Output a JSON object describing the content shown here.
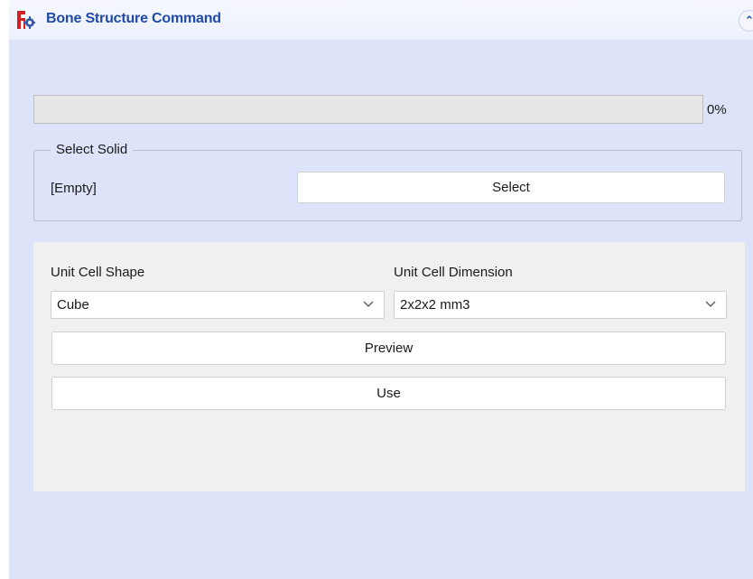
{
  "window": {
    "title": "Bone Structure Command"
  },
  "progress": {
    "value": 0,
    "text": "0%"
  },
  "select_solid": {
    "title": "Select Solid",
    "status": "[Empty]",
    "button_label": "Select"
  },
  "unit_cell": {
    "shape_label": "Unit Cell Shape",
    "shape_value": "Cube",
    "dimension_label": "Unit Cell Dimension",
    "dimension_value": "2x2x2 mm3"
  },
  "actions": {
    "preview_label": "Preview",
    "use_label": "Use"
  },
  "icons": {
    "app": "freecad-gear-icon",
    "collapse": "double-chevron-up-icon",
    "dropdown": "chevron-down-icon"
  },
  "colors": {
    "panel_bg": "#dde3f8",
    "title_text": "#1f4aa8",
    "inner_bg": "#f0f0f0"
  }
}
